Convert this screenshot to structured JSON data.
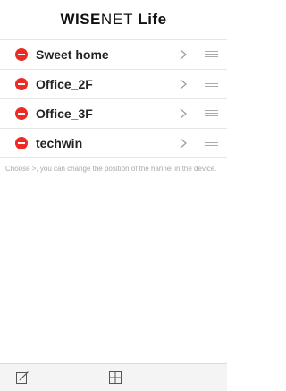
{
  "header": {
    "brand_w": "W",
    "brand_ise": "ISE",
    "brand_net": "NET",
    "brand_life": "Life"
  },
  "channels": [
    {
      "label": "Sweet home"
    },
    {
      "label": "Office_2F"
    },
    {
      "label": "Office_3F"
    },
    {
      "label": "techwin"
    }
  ],
  "hint": "Choose >, you can change the position of the hannel in the device.",
  "icons": {
    "delete": "remove-circle-icon",
    "chevron": "chevron-right-icon",
    "drag": "drag-handle-icon",
    "edit": "edit-icon",
    "grid": "grid-layout-icon"
  },
  "colors": {
    "delete": "#ee2a24",
    "separator": "#e6e6e6",
    "hint_text": "#a8a8a8",
    "toolbar_bg": "#f4f4f4"
  }
}
